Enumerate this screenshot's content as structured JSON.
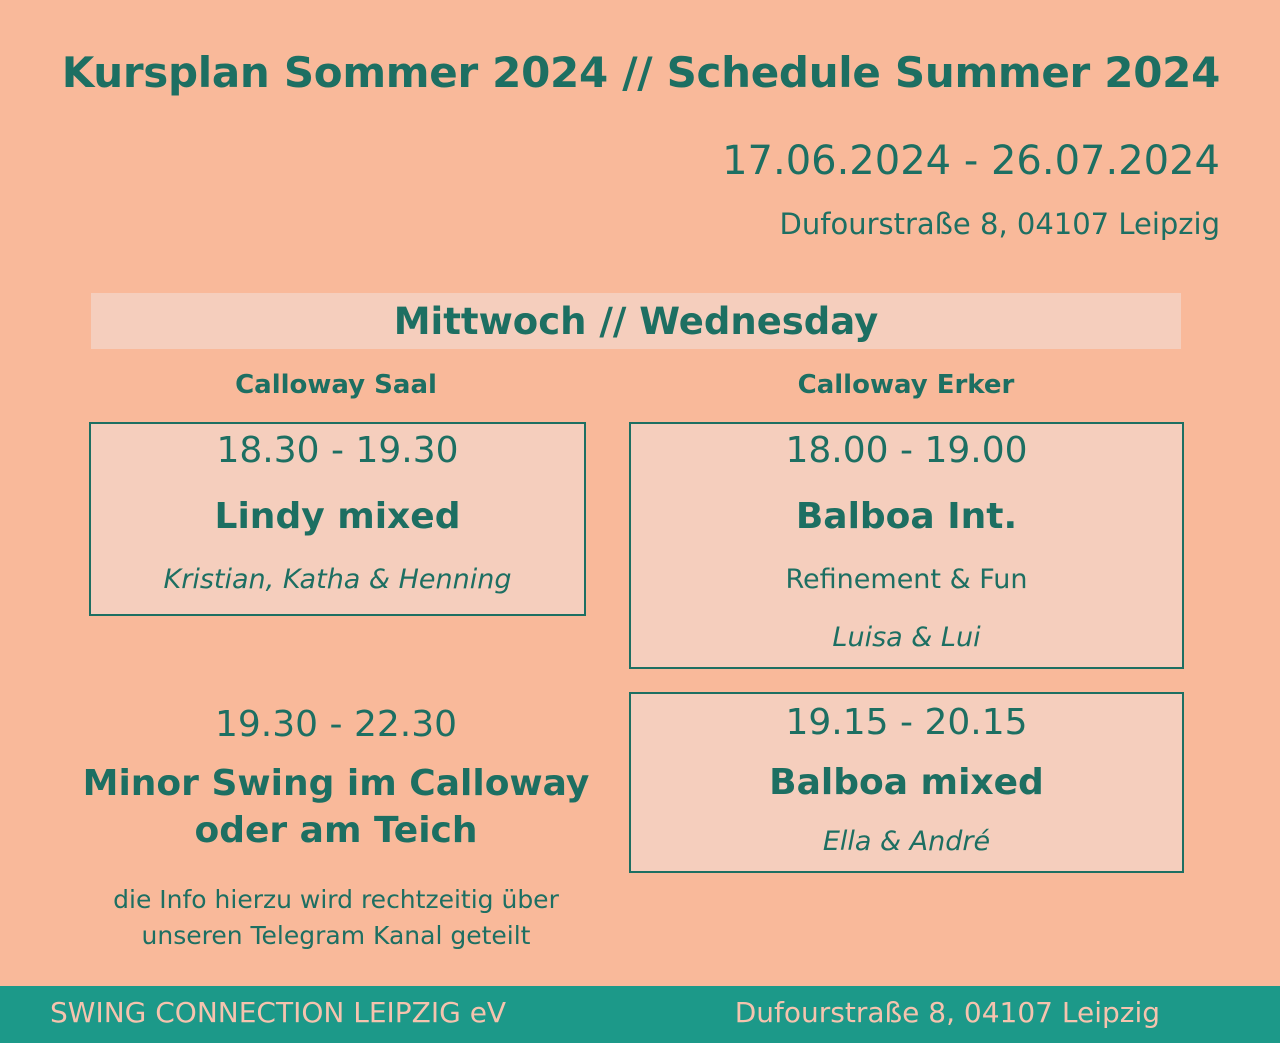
{
  "header": {
    "title": "Kursplan Sommer 2024 // Schedule Summer 2024",
    "dates": "17.06.2024 - 26.07.2024",
    "address": "Dufourstraße 8, 04107 Leipzig"
  },
  "day": "Mittwoch // Wednesday",
  "rooms": {
    "left": "Calloway Saal",
    "right": "Calloway Erker"
  },
  "courses": {
    "left_1": {
      "time": "18.30 - 19.30",
      "name": "Lindy mixed",
      "teachers": "Kristian, Katha & Henning"
    },
    "right_1": {
      "time": "18.00 - 19.00",
      "name": "Balboa Int.",
      "subtitle": "Refinement & Fun",
      "teachers": "Luisa & Lui"
    },
    "right_2": {
      "time": "19.15 - 20.15",
      "name": "Balboa mixed",
      "teachers": "Ella & André"
    },
    "left_2": {
      "time": "19.30 - 22.30",
      "name_line1": "Minor Swing im Calloway",
      "name_line2": "oder am Teich",
      "info_line1": "die Info hierzu wird rechtzeitig über",
      "info_line2": "unseren Telegram Kanal geteilt"
    }
  },
  "footer": {
    "org": "SWING CONNECTION LEIPZIG eV",
    "address": "Dufourstraße 8, 04107 Leipzig"
  },
  "colors": {
    "background": "#f9b99a",
    "panel": "#f5cebd",
    "text": "#1d6f62",
    "footer_bg": "#1c9989",
    "footer_text": "#f5c3ae"
  }
}
